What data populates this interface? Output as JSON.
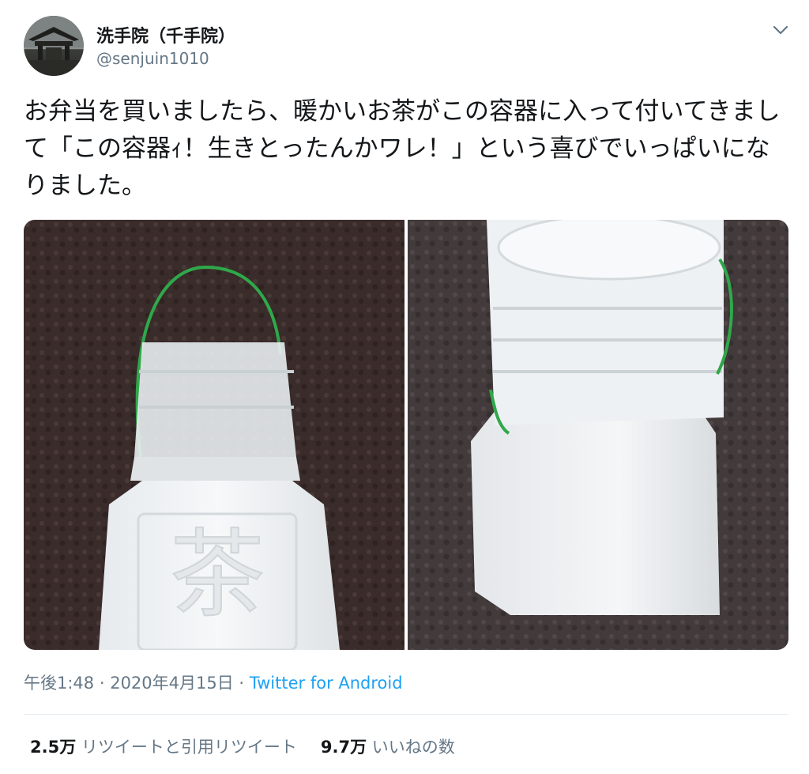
{
  "tweet": {
    "author": {
      "display_name": "洗手院（千手院）",
      "handle": "@senjuin1010",
      "avatar_icon": "temple-gate-avatar"
    },
    "menu_icon": "chevron-down-icon",
    "text": "お弁当を買いましたら、暖かいお茶がこの容器に入って付いてきまして「この容器ｨ！生きとったんかワレ！」という喜びでいっぱいになりました。",
    "photo_left_label": "茶",
    "timestamp": {
      "time": "午後1:48",
      "separator": " · ",
      "date": "2020年4月15日",
      "separator2": " · ",
      "source": "Twitter for Android"
    },
    "stats": {
      "retweets_count": "2.5万",
      "retweets_label": "リツイートと引用リツイート",
      "likes_count": "9.7万",
      "likes_label": "いいねの数"
    }
  },
  "colors": {
    "link": "#1da1f2",
    "secondary_text": "#657786",
    "primary_text": "#14171a"
  }
}
